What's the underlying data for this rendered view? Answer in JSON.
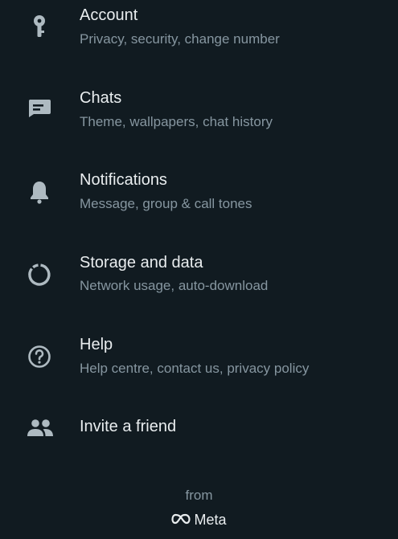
{
  "colors": {
    "background": "#111b21",
    "primary_text": "#e9edef",
    "secondary_text": "#8696a0",
    "icon": "#aebac1"
  },
  "settings": {
    "items": [
      {
        "icon": "key-icon",
        "title": "Account",
        "subtitle": "Privacy, security, change number"
      },
      {
        "icon": "chat-icon",
        "title": "Chats",
        "subtitle": "Theme, wallpapers, chat history"
      },
      {
        "icon": "bell-icon",
        "title": "Notifications",
        "subtitle": "Message, group & call tones"
      },
      {
        "icon": "storage-icon",
        "title": "Storage and data",
        "subtitle": "Network usage, auto-download"
      },
      {
        "icon": "help-icon",
        "title": "Help",
        "subtitle": "Help centre, contact us, privacy policy"
      },
      {
        "icon": "people-icon",
        "title": "Invite a friend"
      }
    ]
  },
  "footer": {
    "from_label": "from",
    "brand_name": "Meta",
    "brand_icon": "meta-infinity-icon"
  }
}
